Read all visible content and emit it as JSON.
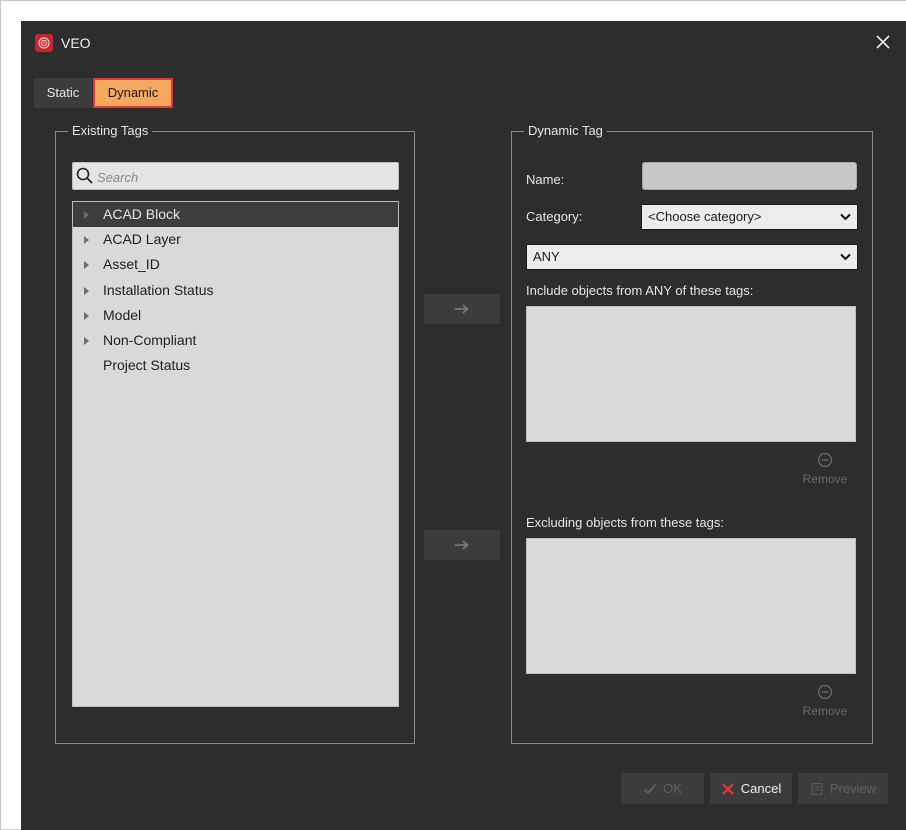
{
  "window": {
    "title": "VEO"
  },
  "tabs": [
    {
      "label": "Static",
      "active": false
    },
    {
      "label": "Dynamic",
      "active": true
    }
  ],
  "existing_tags": {
    "legend": "Existing Tags",
    "search_placeholder": "Search",
    "items": [
      {
        "label": "ACAD Block",
        "expandable": true,
        "selected": true
      },
      {
        "label": "ACAD Layer",
        "expandable": true,
        "selected": false
      },
      {
        "label": "Asset_ID",
        "expandable": true,
        "selected": false
      },
      {
        "label": "Installation Status",
        "expandable": true,
        "selected": false
      },
      {
        "label": "Model",
        "expandable": true,
        "selected": false
      },
      {
        "label": "Non-Compliant",
        "expandable": true,
        "selected": false
      },
      {
        "label": "Project Status",
        "expandable": false,
        "selected": false
      }
    ]
  },
  "dynamic_tag": {
    "legend": "Dynamic Tag",
    "name_label": "Name:",
    "name_value": "",
    "category_label": "Category:",
    "category_value": "<Choose category>",
    "match_value": "ANY",
    "include_label": "Include objects from ANY of these tags:",
    "exclude_label": "Excluding objects from these tags:",
    "remove_label": "Remove"
  },
  "footer": {
    "ok_label": "OK",
    "cancel_label": "Cancel",
    "preview_label": "Preview"
  },
  "colors": {
    "background": "#2d2d2d",
    "active_tab": "#f7a85f",
    "active_tab_border": "#e03a3a",
    "app_icon": "#c0282e",
    "cancel_icon": "#e03a3a"
  }
}
